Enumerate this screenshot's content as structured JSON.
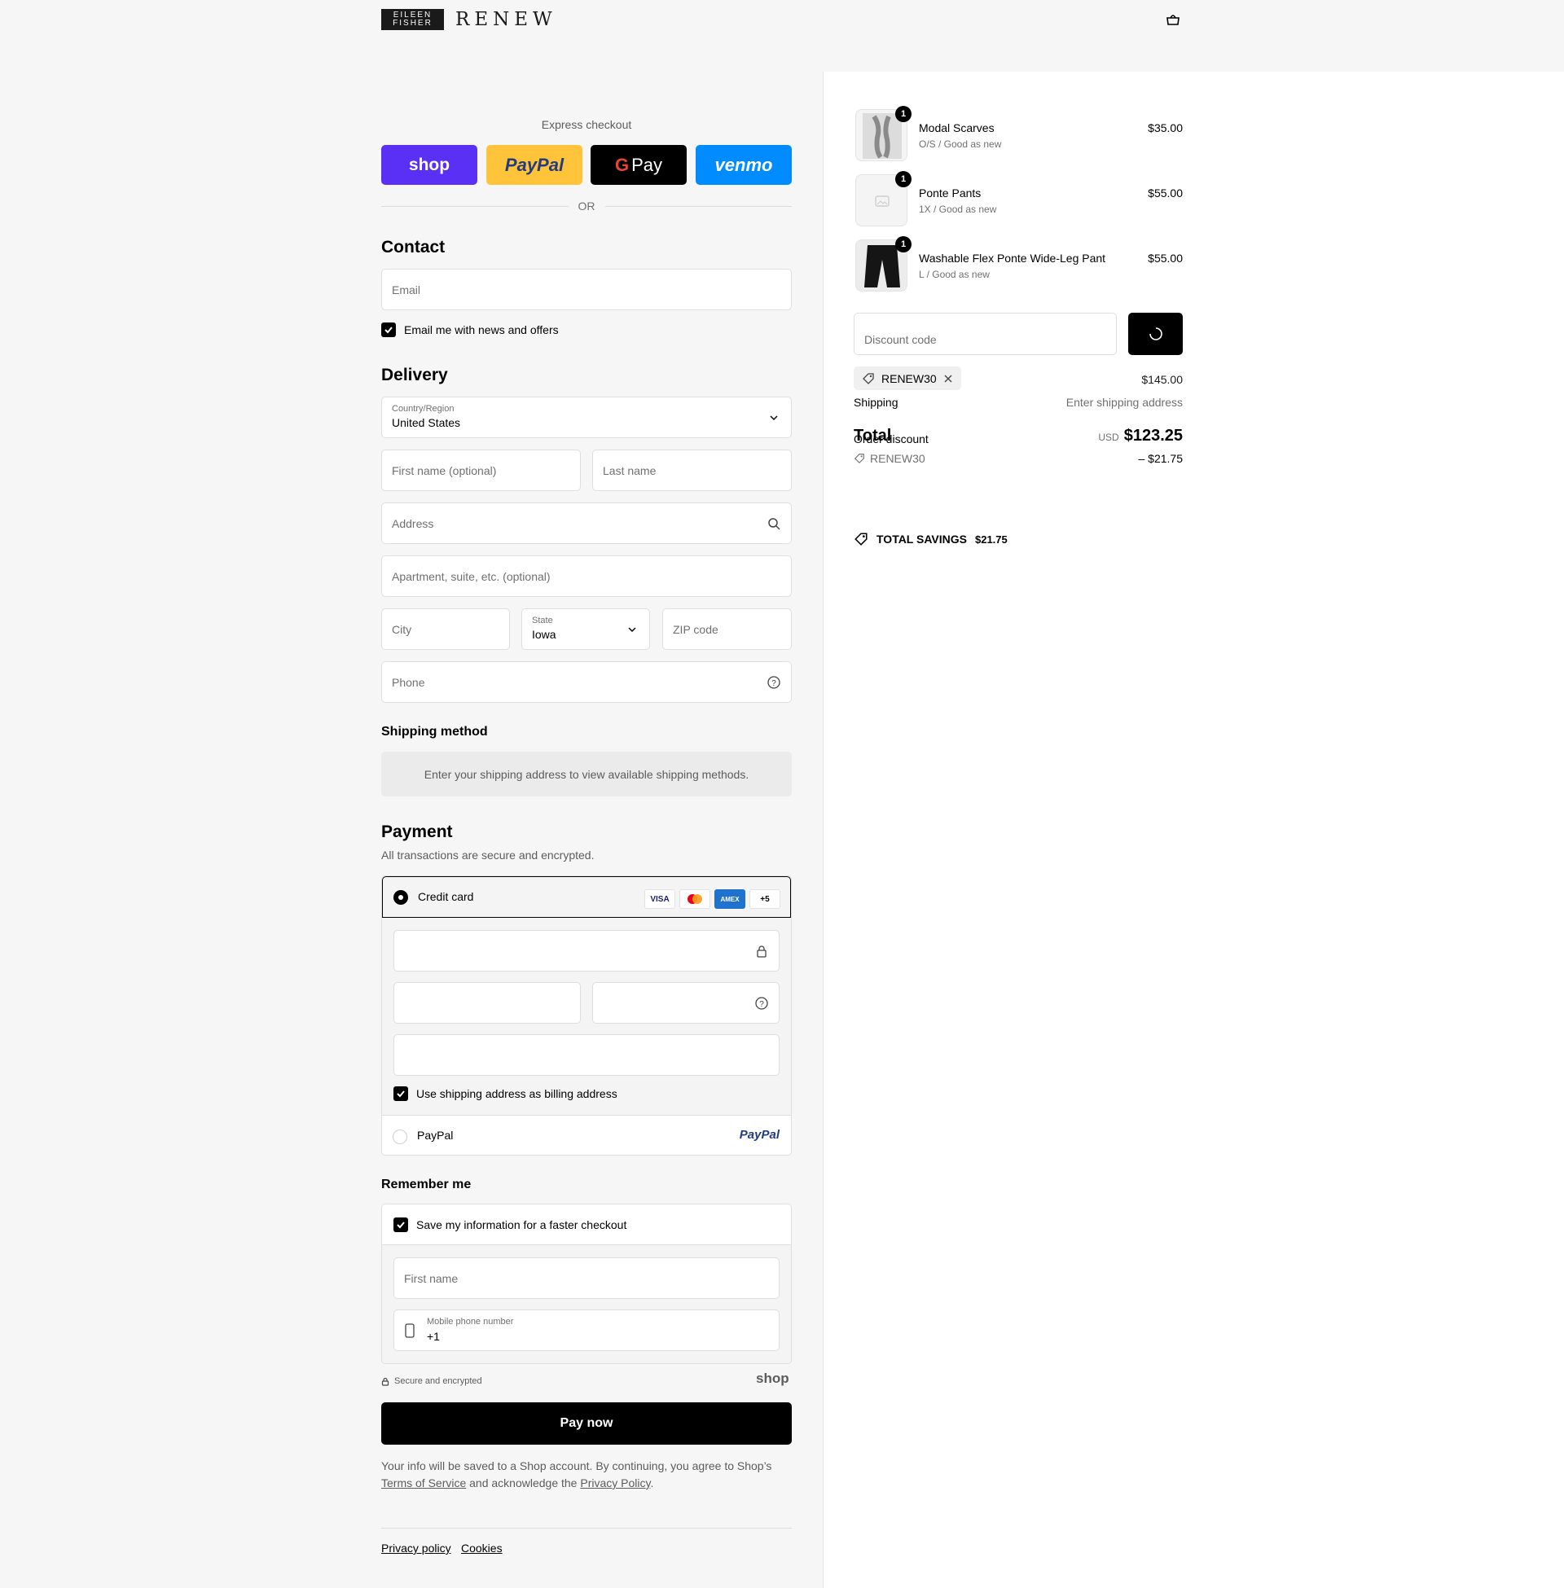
{
  "header": {
    "brand_box_line1": "EILEEN",
    "brand_box_line2": "FISHER",
    "brand_word": "RENEW",
    "cart_icon": "bag-icon"
  },
  "express": {
    "label": "Express checkout",
    "shop": "shop",
    "paypal": "PayPal",
    "gpay_g": "G",
    "gpay": "Pay",
    "venmo": "venmo",
    "or": "OR"
  },
  "contact": {
    "heading": "Contact",
    "email_placeholder": "Email",
    "news_label": "Email me with news and offers"
  },
  "delivery": {
    "heading": "Delivery",
    "country_label": "Country/Region",
    "country_value": "United States",
    "first_name_placeholder": "First name (optional)",
    "last_name_placeholder": "Last name",
    "address_placeholder": "Address",
    "apartment_placeholder": "Apartment, suite, etc. (optional)",
    "city_placeholder": "City",
    "state_label": "State",
    "state_value": "Iowa",
    "zip_placeholder": "ZIP code",
    "phone_placeholder": "Phone"
  },
  "shipping_method": {
    "heading": "Shipping method",
    "info": "Enter your shipping address to view available shipping methods."
  },
  "payment": {
    "heading": "Payment",
    "subtitle": "All transactions are secure and encrypted.",
    "credit_card_label": "Credit card",
    "card_logos": [
      "VISA",
      "MC",
      "AMEX",
      "+5"
    ],
    "billing_label": "Use shipping address as billing address",
    "paypal_label": "PayPal",
    "paypal_logo": "PayPal"
  },
  "remember": {
    "heading": "Remember me",
    "save_label": "Save my information for a faster checkout",
    "first_name_placeholder": "First name",
    "mobile_label": "Mobile phone number",
    "mobile_value": "+1",
    "secure_text": "Secure and encrypted",
    "shop_logo": "shop"
  },
  "pay_now": "Pay now",
  "fine_print": {
    "before": "Your info will be saved to a Shop account. By continuing, you agree to Shop’s",
    "terms": "Terms of Service",
    "middle": "and acknowledge the",
    "privacy": "Privacy Policy",
    "end": "."
  },
  "footer": {
    "privacy": "Privacy policy",
    "cookies": "Cookies"
  },
  "summary": {
    "items": [
      {
        "name": "Modal Scarves",
        "variant": "O/S / Good as new",
        "qty": "1",
        "price": "$35.00"
      },
      {
        "name": "Ponte Pants",
        "variant": "1X / Good as new",
        "qty": "1",
        "price": "$55.00"
      },
      {
        "name": "Washable Flex Ponte Wide-Leg Pant",
        "variant": "L / Good as new",
        "qty": "1",
        "price": "$55.00"
      }
    ],
    "discount_placeholder": "Discount code",
    "applied_code": "RENEW30",
    "subtotal_value": "$145.00",
    "shipping_label": "Shipping",
    "shipping_value": "Enter shipping address",
    "total_label": "Total",
    "order_discount_label": "Order discount",
    "currency": "USD",
    "total_value": "$123.25",
    "discount_code_line": "RENEW30",
    "discount_amount": "– $21.75",
    "savings_label": "TOTAL SAVINGS",
    "savings_value": "$21.75"
  }
}
